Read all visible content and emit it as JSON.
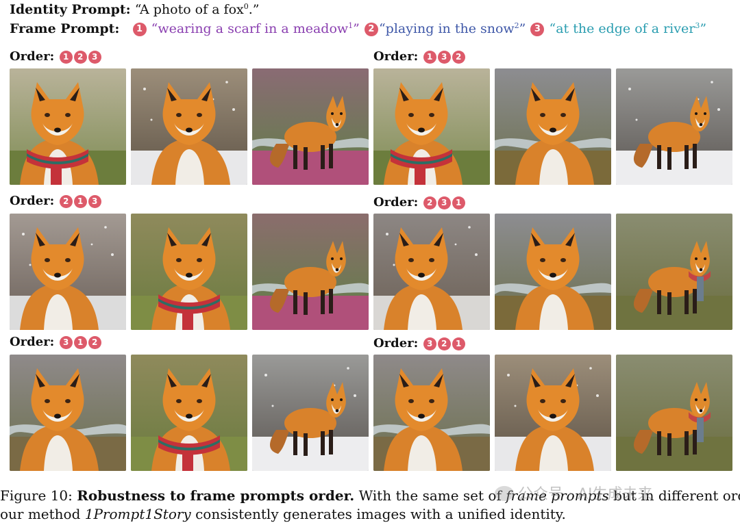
{
  "identity_prompt": {
    "label": "Identity Prompt:",
    "text_before": "“A photo of a fox",
    "sup": "0",
    "text_after": ".”"
  },
  "frame_prompt": {
    "label": "Frame Prompt:",
    "items": [
      {
        "num": "1",
        "text": "“wearing a scarf in a meadow",
        "sup": "1",
        "close": "”",
        "color": "#8a3fb0"
      },
      {
        "num": "2",
        "text": "“playing in the snow",
        "sup": "2",
        "close": "”",
        "color": "#3f58a8"
      },
      {
        "num": "3",
        "text": "“at the edge of a river",
        "sup": "3",
        "close": "”",
        "color": "#2a9db0"
      }
    ]
  },
  "order_label": "Order:",
  "badge_color": "#dd5a6a",
  "orders": [
    {
      "badges": [
        "1",
        "2",
        "3"
      ],
      "images": [
        "fox-scarf-meadow",
        "fox-snow-portrait",
        "fox-standing-heather"
      ]
    },
    {
      "badges": [
        "1",
        "3",
        "2"
      ],
      "images": [
        "fox-scarf-meadow",
        "fox-river-valley",
        "fox-walking-snow"
      ]
    },
    {
      "badges": [
        "2",
        "1",
        "3"
      ],
      "images": [
        "fox-snowfall-profile",
        "fox-scarf-flowers",
        "fox-standing-river"
      ]
    },
    {
      "badges": [
        "2",
        "3",
        "1"
      ],
      "images": [
        "fox-snowy-hillside",
        "fox-river-valley",
        "fox-scarf-field"
      ]
    },
    {
      "badges": [
        "3",
        "1",
        "2"
      ],
      "images": [
        "fox-river-bank",
        "fox-scarf-flowers",
        "fox-walking-snow"
      ]
    },
    {
      "badges": [
        "3",
        "2",
        "1"
      ],
      "images": [
        "fox-river-bank",
        "fox-snow-portrait",
        "fox-scarf-field"
      ]
    }
  ],
  "caption": {
    "fig": "Figure 10:",
    "bold": "Robustness to frame prompts order.",
    "part1": "With the same set of",
    "italic1": "frame prompts",
    "part2": "but in different orders,",
    "part3": "our method",
    "italic2": "1Prompt1Story",
    "part4": "consistently generates images with a unified identity."
  },
  "watermark": "公众号 · AI生成未来"
}
